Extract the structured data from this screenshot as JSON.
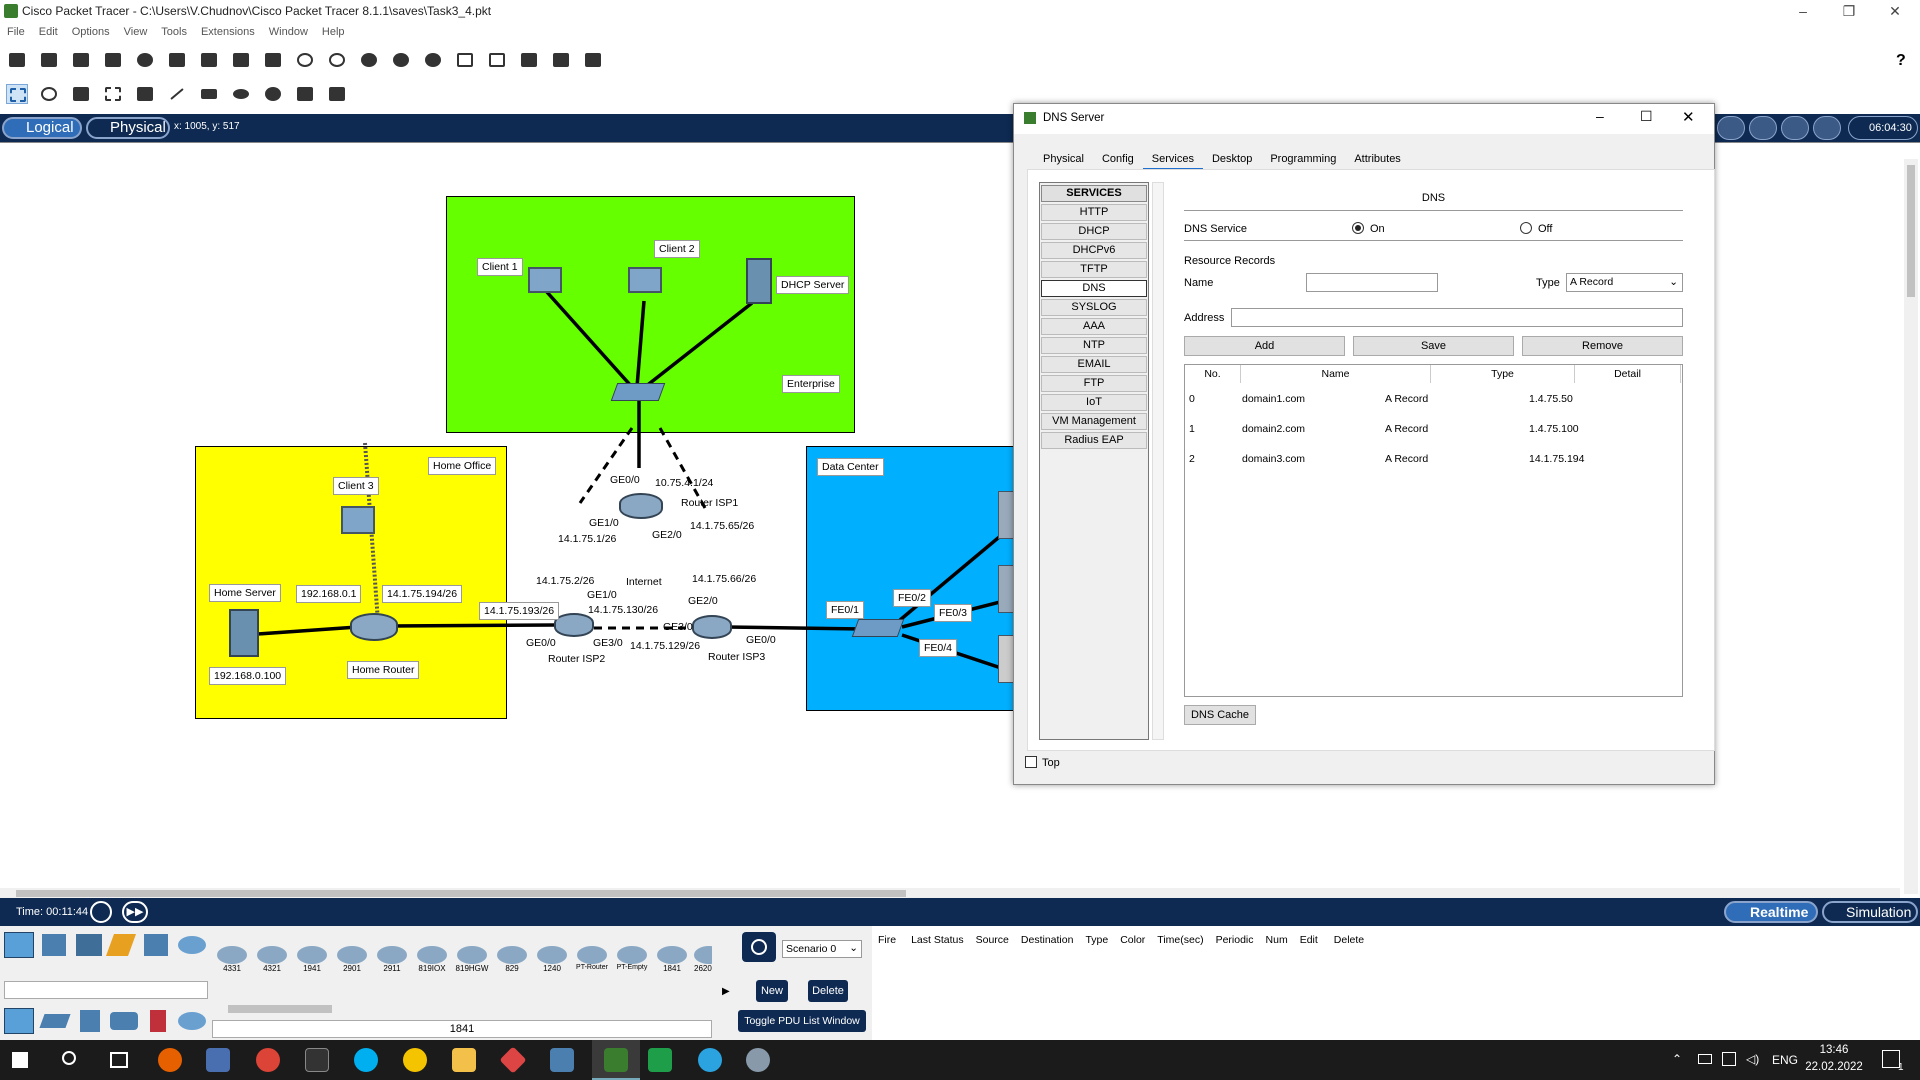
{
  "window": {
    "title": "Cisco Packet Tracer - C:\\Users\\V.Chudnov\\Cisco Packet Tracer 8.1.1\\saves\\Task3_4.pkt"
  },
  "menu": [
    "File",
    "Edit",
    "Options",
    "View",
    "Tools",
    "Extensions",
    "Window",
    "Help"
  ],
  "logical_bar": {
    "logical": "Logical",
    "physical": "Physical",
    "coords": "x: 1005, y: 517",
    "clock": "06:04:30"
  },
  "topology": {
    "zones": {
      "enterprise": "Enterprise",
      "home_office": "Home Office",
      "data_center": "Data Center"
    },
    "devices": {
      "client1": "Client 1",
      "client2": "Client 2",
      "dhcp_server": "DHCP Server",
      "client3": "Client 3",
      "home_server": "Home Server",
      "home_router": "Home Router",
      "router_isp1": "Router ISP1",
      "router_isp2": "Router ISP2",
      "router_isp3": "Router ISP3",
      "internet": "Internet"
    },
    "labels": {
      "hs_ip": "192.168.0.100",
      "hr_lan": "192.168.0.1",
      "hr_wan": "14.1.75.194/26",
      "isp2_ge00": "14.1.75.193/26",
      "isp1_ge00": "GE0/0",
      "isp1_ge00_ip": "10.75.4.1/24",
      "isp1_ge10": "GE1/0",
      "isp1_ge10_ip": "14.1.75.1/26",
      "isp1_ge20": "GE2/0",
      "isp1_ge20_ip": "14.1.75.65/26",
      "isp2_ge10_ip": "14.1.75.2/26",
      "isp2_ge10": "GE1/0",
      "isp2_ge30_ip": "14.1.75.130/26",
      "isp2_ge00_if": "GE0/0",
      "isp2_ge30": "GE3/0",
      "isp3_ge20_ip": "14.1.75.66/26",
      "isp3_ge20": "GE2/0",
      "isp3_ge30": "GE3/0",
      "isp3_ge30_ip": "14.1.75.129/26",
      "isp3_ge00": "GE0/0",
      "fe01": "FE0/1",
      "fe02": "FE0/2",
      "fe03": "FE0/3",
      "fe04": "FE0/4"
    }
  },
  "dialog": {
    "title": "DNS Server",
    "tabs": [
      "Physical",
      "Config",
      "Services",
      "Desktop",
      "Programming",
      "Attributes"
    ],
    "services_header": "SERVICES",
    "services": [
      "HTTP",
      "DHCP",
      "DHCPv6",
      "TFTP",
      "DNS",
      "SYSLOG",
      "AAA",
      "NTP",
      "EMAIL",
      "FTP",
      "IoT",
      "VM Management",
      "Radius EAP"
    ],
    "section_title": "DNS",
    "dns_service_label": "DNS Service",
    "on_label": "On",
    "off_label": "Off",
    "resource_records": "Resource Records",
    "name_label": "Name",
    "name_value": "",
    "type_label": "Type",
    "type_value": "A Record",
    "address_label": "Address",
    "address_value": "",
    "add": "Add",
    "save": "Save",
    "remove": "Remove",
    "columns": [
      "No.",
      "Name",
      "Type",
      "Detail"
    ],
    "records": [
      {
        "no": "0",
        "name": "domain1.com",
        "type": "A Record",
        "detail": "1.4.75.50"
      },
      {
        "no": "1",
        "name": "domain2.com",
        "type": "A Record",
        "detail": "1.4.75.100"
      },
      {
        "no": "2",
        "name": "domain3.com",
        "type": "A Record",
        "detail": "14.1.75.194"
      }
    ],
    "dns_cache": "DNS Cache",
    "top_label": "Top"
  },
  "simbar": {
    "time": "Time: 00:11:44",
    "realtime": "Realtime",
    "simulation": "Simulation"
  },
  "bottom": {
    "models": [
      "4331",
      "4321",
      "1941",
      "2901",
      "2911",
      "819IOX",
      "819HGW",
      "829",
      "1240",
      "PT-Router",
      "PT-Empty",
      "1841",
      "2620"
    ],
    "selected_model": "1841",
    "scenario": "Scenario 0",
    "new": "New",
    "delete": "Delete",
    "toggle": "Toggle PDU List Window",
    "pdu_columns": [
      "Fire",
      "Last Status",
      "Source",
      "Destination",
      "Type",
      "Color",
      "Time(sec)",
      "Periodic",
      "Num",
      "Edit",
      "Delete"
    ]
  },
  "taskbar": {
    "lang": "ENG",
    "time": "13:46",
    "date": "22.02.2022",
    "notif": "1"
  },
  "colors": {
    "enterprise": "#66ff00",
    "home_office": "#ffff00",
    "data_center": "#00b0ff",
    "bar": "#0e2a52"
  }
}
